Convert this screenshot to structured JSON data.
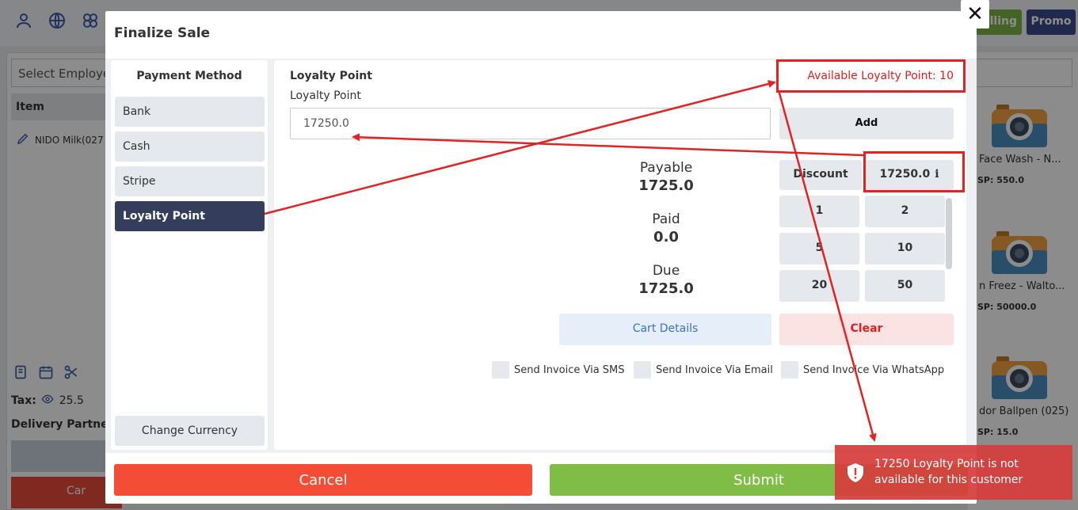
{
  "background": {
    "select_placeholder": "Select Employee",
    "item_column": "Item",
    "item_row": "NIDO Milk(027",
    "tax_label": "Tax:",
    "tax_value": "25.5",
    "delivery_label": "Delivery Partner:",
    "cancel_partial": "Car",
    "billing_label": "lling",
    "promo_label": "Promo",
    "products": [
      {
        "name": "Face Wash - N...",
        "price": "SP: 550.0"
      },
      {
        "name": "n Freez - Walto...",
        "price": "SP: 50000.0"
      },
      {
        "name": "dor Ballpen (025)",
        "price": "SP: 15.0"
      }
    ]
  },
  "modal": {
    "title": "Finalize Sale",
    "close_glyph": "✕"
  },
  "payment_methods": {
    "title": "Payment Method",
    "items": [
      {
        "label": "Bank",
        "active": false
      },
      {
        "label": "Cash",
        "active": false
      },
      {
        "label": "Stripe",
        "active": false
      },
      {
        "label": "Loyalty Point",
        "active": true
      }
    ],
    "change_currency": "Change Currency"
  },
  "loyalty": {
    "heading": "Loyalty Point",
    "field_label": "Loyalty Point",
    "input_value": "17250.0",
    "available_text": "Available Loyalty Point: 10",
    "add_label": "Add"
  },
  "summary": {
    "payable_label": "Payable",
    "payable_value": "1725.0",
    "paid_label": "Paid",
    "paid_value": "0.0",
    "due_label": "Due",
    "due_value": "1725.0"
  },
  "discount": {
    "label": "Discount",
    "value": "17250.0",
    "info_glyph": "i"
  },
  "keypad": [
    "1",
    "2",
    "5",
    "10",
    "20",
    "50"
  ],
  "actions": {
    "cart_details": "Cart Details",
    "clear": "Clear",
    "cancel": "Cancel",
    "submit": "Submit"
  },
  "send_options": [
    {
      "label": "Send Invoice Via SMS"
    },
    {
      "label": "Send Invoice Via Email"
    },
    {
      "label": "Send Invoice Via WhatsApp"
    }
  ],
  "toast": {
    "message": "17250 Loyalty Point is not available for this customer"
  },
  "colors": {
    "annotation": "#e52222",
    "active_method": "#353d5c",
    "cancel": "#f44d36",
    "submit": "#80bd47",
    "toast": "#d63c3c"
  }
}
